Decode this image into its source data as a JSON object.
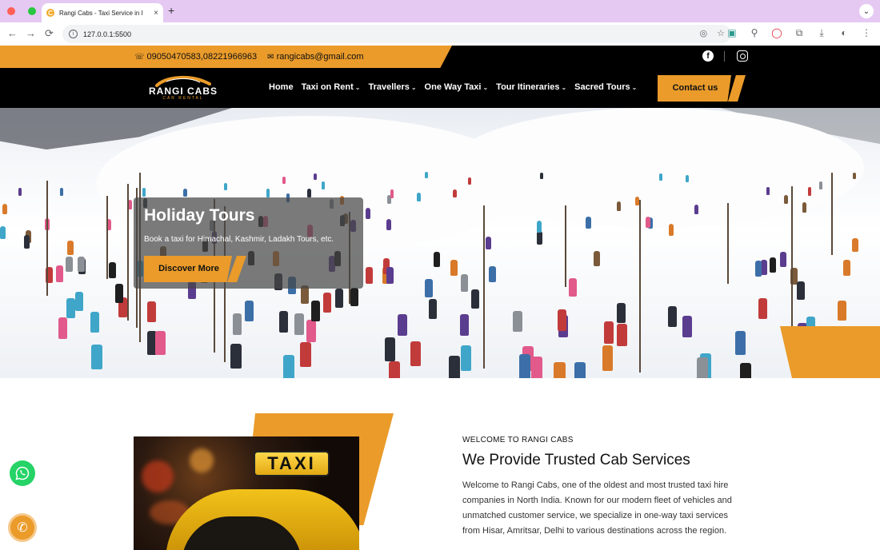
{
  "browser": {
    "tab_title": "Rangi Cabs - Taxi Service in I",
    "favicon_letter": "C",
    "tab_close": "×",
    "new_tab": "+",
    "tab_menu": "⌄",
    "url": "127.0.0.1:5500",
    "nav": {
      "back": "←",
      "forward": "→",
      "reload": "⟳"
    }
  },
  "topbar": {
    "phone": "09050470583,08221966963",
    "email": "rangicabs@gmail.com",
    "phone_icon": "phone-icon",
    "email_icon": "envelope-icon",
    "facebook_glyph": "f"
  },
  "header": {
    "logo_text": "RANGI CABS",
    "logo_sub": "CAR RENTAL",
    "nav": [
      {
        "label": "Home",
        "dropdown": false
      },
      {
        "label": "Taxi on Rent",
        "dropdown": true
      },
      {
        "label": "Travellers",
        "dropdown": true
      },
      {
        "label": "One Way Taxi",
        "dropdown": true
      },
      {
        "label": "Tour Itineraries",
        "dropdown": true
      },
      {
        "label": "Sacred Tours",
        "dropdown": true
      }
    ],
    "chevron": "⌄",
    "contact_label": "Contact us"
  },
  "hero": {
    "title": "Holiday Tours",
    "subtitle": "Book a taxi for Himachal, Kashmir, Ladakh Tours, etc.",
    "button_label": "Discover More"
  },
  "about": {
    "kicker": "WELCOME TO RANGI CABS",
    "title": "We Provide Trusted Cab Services",
    "body": "Welcome to Rangi Cabs, one of the oldest and most trusted taxi hire companies in North India. Known for our modern fleet of vehicles and unmatched customer service, we specialize in one-way taxi services from Hisar, Amritsar, Delhi to various destinations across the region.",
    "image_sign": "TAXI"
  },
  "colors": {
    "accent": "#ea9b2a",
    "dark": "#000000",
    "whatsapp": "#25d366"
  }
}
